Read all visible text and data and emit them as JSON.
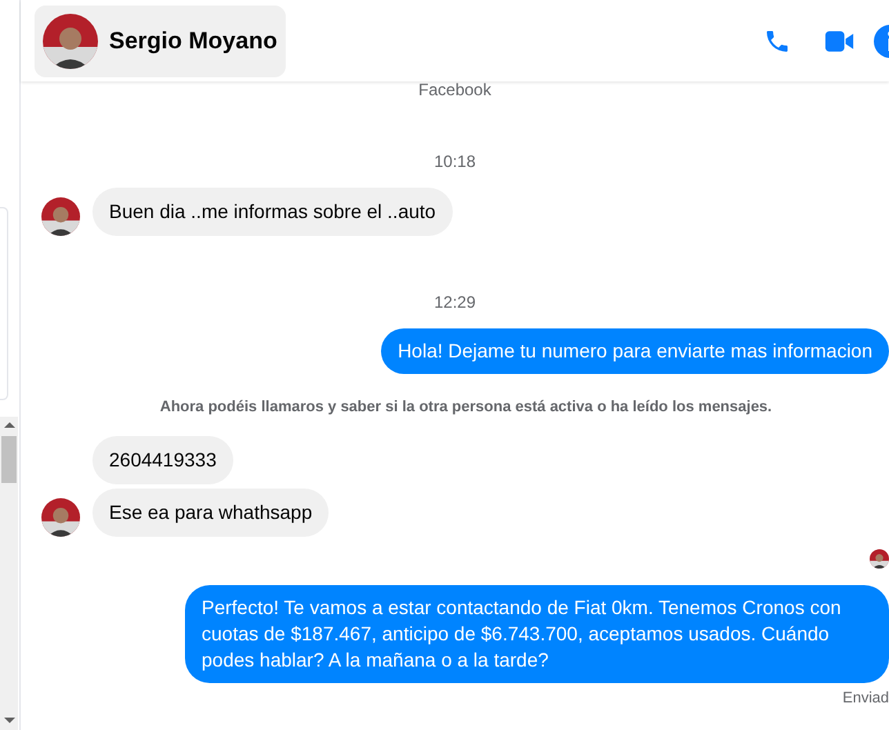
{
  "header": {
    "name": "Sergio Moyano"
  },
  "messages": [
    {
      "kind": "cut",
      "text": "Facebook"
    },
    {
      "kind": "time",
      "text": "10:18"
    },
    {
      "kind": "incoming",
      "text": "Buen dia ..me informas sobre el ..auto",
      "avatar": true
    },
    {
      "kind": "time",
      "text": "12:29"
    },
    {
      "kind": "outgoing",
      "text": "Hola! Dejame tu numero para enviarte mas informacion"
    },
    {
      "kind": "notice",
      "text": "Ahora podéis llamaros y saber si la otra persona está activa o ha leído los mensajes."
    },
    {
      "kind": "incoming",
      "text": "2604419333",
      "avatar": false
    },
    {
      "kind": "incoming",
      "text": "Ese ea para whathsapp",
      "avatar": true
    },
    {
      "kind": "seen"
    },
    {
      "kind": "outgoing",
      "text": "Perfecto! Te vamos a estar contactando de Fiat 0km. Tenemos Cronos con cuotas de $187.467, anticipo de $6.743.700, aceptamos usados. Cuándo podes hablar? A la mañana o a la tarde?"
    },
    {
      "kind": "status",
      "text": "Enviad"
    }
  ]
}
